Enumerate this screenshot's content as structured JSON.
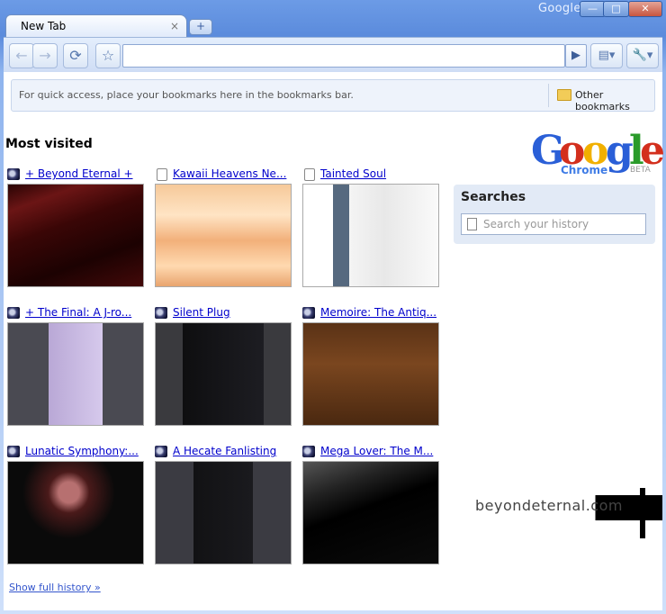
{
  "window": {
    "brand": "Google",
    "minimize": "—",
    "maximize": "□",
    "close": "✕"
  },
  "tabs": [
    {
      "label": "New Tab",
      "close": "×"
    }
  ],
  "new_tab_button": "+",
  "toolbar": {
    "back": "←",
    "forward": "→",
    "reload": "⟳",
    "star": "☆",
    "go": "▶",
    "page_menu": "▤▾",
    "tools_menu": "🔧▾"
  },
  "omnibox": {
    "value": ""
  },
  "bookmarks_bar": {
    "hint": "For quick access, place your bookmarks here in the bookmarks bar.",
    "other": "Other bookmarks"
  },
  "most_visited": {
    "heading": "Most visited",
    "tiles": [
      {
        "title": "+ Beyond Eternal +",
        "icon": "site-favicon"
      },
      {
        "title": "Kawaii Heavens Ne...",
        "icon": "page-icon"
      },
      {
        "title": "Tainted Soul",
        "icon": "page-icon"
      },
      {
        "title": "+ The Final: A J-ro...",
        "icon": "site-favicon"
      },
      {
        "title": "Silent Plug",
        "icon": "site-favicon"
      },
      {
        "title": "Memoire: The Antiq...",
        "icon": "site-favicon"
      },
      {
        "title": "Lunatic Symphony:...",
        "icon": "site-favicon"
      },
      {
        "title": "A Hecate Fanlisting",
        "icon": "site-favicon"
      },
      {
        "title": "Mega Lover: The M...",
        "icon": "site-favicon"
      }
    ]
  },
  "logo": {
    "letters": [
      "G",
      "o",
      "o",
      "g",
      "l",
      "e"
    ],
    "colors": [
      "#2a5fd7",
      "#d32f1d",
      "#f1b000",
      "#2a5fd7",
      "#2a9b2a",
      "#d32f1d"
    ],
    "sub": "Chrome",
    "tag": "BETA"
  },
  "searches": {
    "heading": "Searches",
    "placeholder": "Search your history"
  },
  "footer": {
    "history_link": "Show full history »"
  },
  "watermark": {
    "text": "beyondeternal.com",
    "emblem": "EUH"
  }
}
